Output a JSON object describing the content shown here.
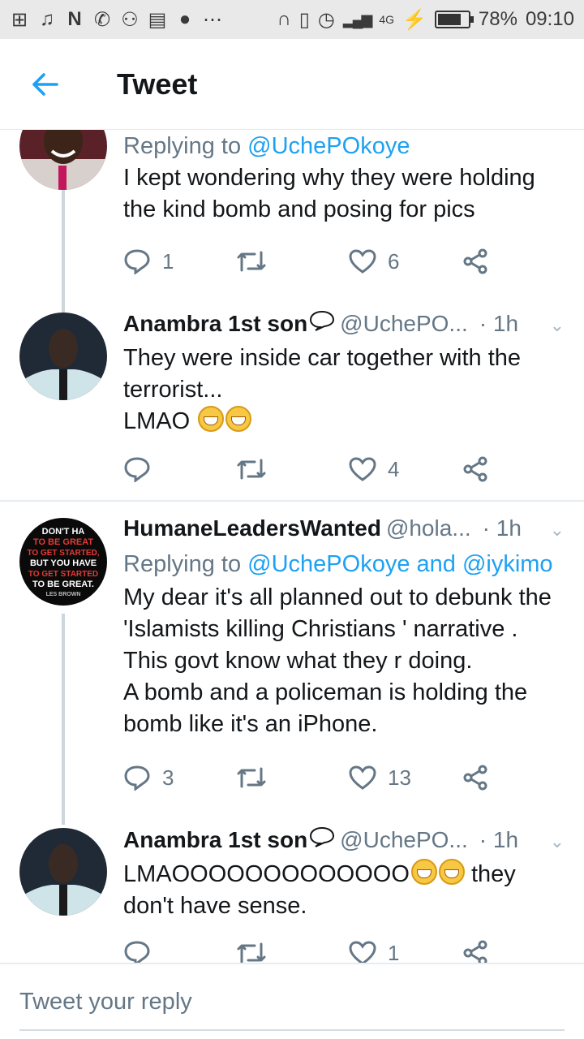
{
  "status_bar": {
    "battery": "78%",
    "battery_level": 0.78,
    "time": "09:10",
    "network": "4G"
  },
  "header": {
    "title": "Tweet"
  },
  "tweets": [
    {
      "replying_to": "Replying to",
      "mentions": "@UchePOkoye",
      "text_lines": [
        "I kept wondering why they were holding",
        "the kind bomb and posing for pics"
      ],
      "replies": "1",
      "likes": "6"
    },
    {
      "name": "Anambra 1st son",
      "handle": "@UchePO...",
      "time": "· 1h",
      "text_lines": [
        "They were inside car together with the",
        "terrorist...",
        "LMAO"
      ],
      "replies": "",
      "likes": "4"
    },
    {
      "name": "HumaneLeadersWanted",
      "handle": "@hola...",
      "time": "· 1h",
      "replying_to": "Replying to",
      "mentions": "@UchePOkoye and @iykimo",
      "text_lines": [
        "My dear it's all planned out to debunk the",
        "'Islamists killing Christians ' narrative .",
        "This govt know what they r doing.",
        "A bomb and a policeman is holding the",
        "bomb like it's an iPhone."
      ],
      "replies": "3",
      "likes": "13",
      "avatar_text": [
        "DON'T HA",
        "TO BE GREAT",
        "TO GET STARTED,",
        "BUT YOU HAVE",
        "TO GET STARTED",
        "TO BE GREAT.",
        "LES BROWN"
      ]
    },
    {
      "name": "Anambra 1st son",
      "handle": "@UchePO...",
      "time": "· 1h",
      "text_lines": [
        "LMAOOOOOOOOOOOOO",
        "they",
        "don't have sense."
      ],
      "replies": "",
      "likes": "1"
    }
  ],
  "reply_bar": {
    "placeholder": "Tweet your reply"
  },
  "colors": {
    "accent": "#1da1f2",
    "secondary_text": "#657786",
    "divider": "#e6ecf0"
  }
}
